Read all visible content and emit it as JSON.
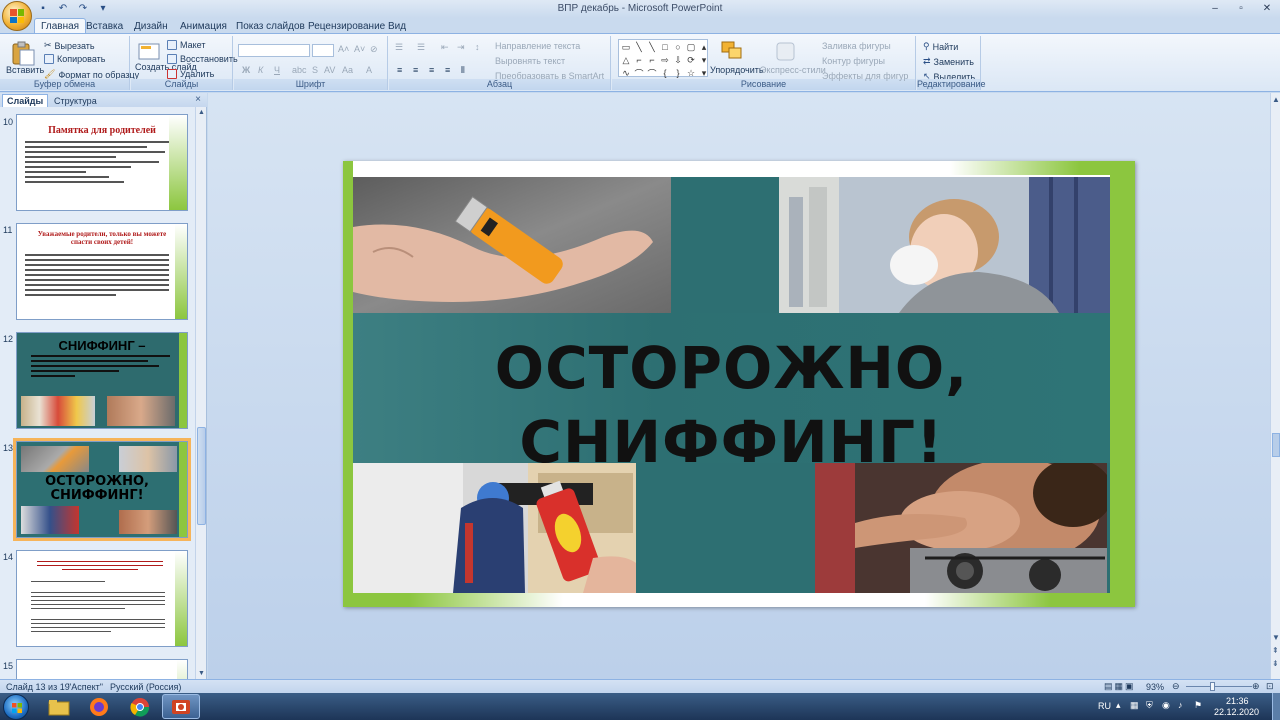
{
  "window": {
    "title": "ВПР декабрь - Microsoft PowerPoint",
    "controls": [
      "–",
      "▫",
      "✕"
    ]
  },
  "ribbon_tabs": [
    "Главная",
    "Вставка",
    "Дизайн",
    "Анимация",
    "Показ слайдов",
    "Рецензирование",
    "Вид"
  ],
  "ribbon": {
    "clipboard": {
      "label": "Буфер обмена",
      "paste": "Вставить",
      "cut": "Вырезать",
      "copy": "Копировать",
      "format_painter": "Формат по образцу"
    },
    "slides": {
      "label": "Слайды",
      "new_slide": "Создать слайд",
      "layout": "Макет",
      "reset": "Восстановить",
      "delete": "Удалить"
    },
    "font": {
      "label": "Шрифт",
      "bold": "Ж",
      "italic": "К",
      "underline": "Ч"
    },
    "paragraph": {
      "label": "Абзац",
      "text_direction": "Направление текста",
      "align_text": "Выровнять текст",
      "smartart": "Преобразовать в SmartArt"
    },
    "drawing": {
      "label": "Рисование",
      "arrange": "Упорядочить",
      "quick_styles": "Экспресс-стили",
      "shape_fill": "Заливка фигуры",
      "shape_outline": "Контур фигуры",
      "shape_effects": "Эффекты для фигур"
    },
    "editing": {
      "label": "Редактирование",
      "find": "Найти",
      "replace": "Заменить",
      "select": "Выделить"
    }
  },
  "panel": {
    "tab_slides": "Слайды",
    "tab_outline": "Структура",
    "close": "×",
    "thumbnails": [
      {
        "number": "10",
        "title": "Памятка для родителей"
      },
      {
        "number": "11",
        "title": "Уважаемые родители, только вы можете спасти своих детей!"
      },
      {
        "number": "12",
        "title": "СНИФФИНГ –"
      },
      {
        "number": "13",
        "title": "ОСТОРОЖНО, СНИФФИНГ!"
      },
      {
        "number": "14",
        "title": ""
      },
      {
        "number": "15",
        "title": ""
      }
    ]
  },
  "slide": {
    "title_line1": "ОСТОРОЖНО,",
    "title_line2": "СНИФФИНГ!"
  },
  "status": {
    "slide_counter": "Слайд 13 из 19",
    "theme": "\"Аспект\"",
    "language": "Русский (Россия)",
    "zoom": "93%"
  },
  "tray": {
    "lang": "RU",
    "time": "21:36",
    "date": "22.12.2020"
  },
  "colors": {
    "accent_green": "#8cc63f",
    "teal": "#2d6f72",
    "selection_orange": "#f6b45a",
    "title_red": "#b01b1b"
  }
}
